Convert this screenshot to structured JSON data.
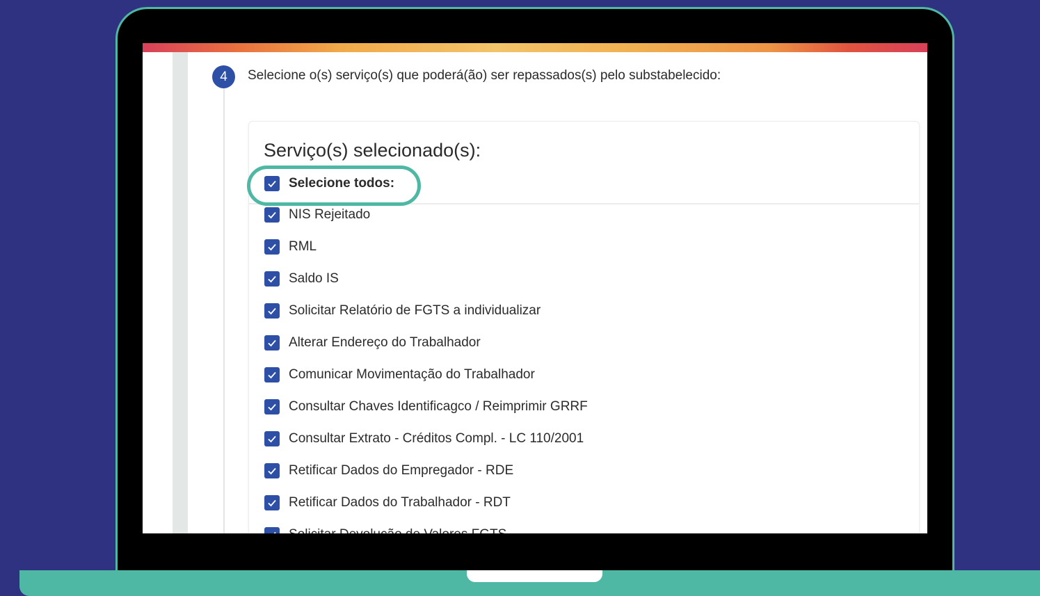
{
  "step": {
    "number": "4",
    "title": "Selecione o(s) serviço(s) que poderá(ão) ser repassados(s) pelo substabelecido:"
  },
  "card": {
    "title": "Serviço(s) selecionado(s):",
    "select_all_label": "Selecione todos:",
    "services": [
      {
        "label": "NIS Rejeitado",
        "checked": true
      },
      {
        "label": "RML",
        "checked": true
      },
      {
        "label": "Saldo IS",
        "checked": true
      },
      {
        "label": "Solicitar Relatório de FGTS a individualizar",
        "checked": true
      },
      {
        "label": "Alterar Endereço do Trabalhador",
        "checked": true
      },
      {
        "label": "Comunicar Movimentação do Trabalhador",
        "checked": true
      },
      {
        "label": "Consultar Chaves Identificagco / Reimprimir GRRF",
        "checked": true
      },
      {
        "label": "Consultar Extrato - Créditos Compl. - LC 110/2001",
        "checked": true
      },
      {
        "label": "Retificar Dados do Empregador - RDE",
        "checked": true
      },
      {
        "label": "Retificar Dados do Trabalhador - RDT",
        "checked": true
      },
      {
        "label": "Solicitar Devolução de Valores FGTS",
        "checked": true
      }
    ]
  },
  "colors": {
    "background": "#2f3181",
    "laptop_accent": "#4fb8a4",
    "checkbox": "#2d4fa6"
  }
}
